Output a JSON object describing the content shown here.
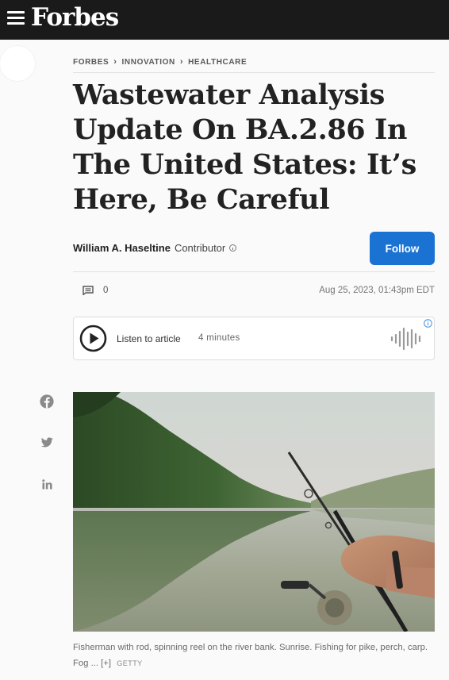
{
  "header": {
    "logo": "Forbes"
  },
  "breadcrumb": [
    "FORBES",
    "INNOVATION",
    "HEALTHCARE"
  ],
  "article": {
    "title_lines": [
      "Wastewater Analysis",
      "Update On BA.2.86 In",
      "The United States: It’s",
      "Here, Be Careful"
    ],
    "author": "William A. Haseltine",
    "role": "Contributor",
    "follow_label": "Follow",
    "comment_count": "0",
    "timestamp": "Aug 25, 2023, 01:43pm EDT"
  },
  "listen": {
    "label": "Listen to article",
    "duration": "4 minutes"
  },
  "social": [
    "facebook-icon",
    "twitter-icon",
    "linkedin-icon"
  ],
  "image": {
    "caption": "Fisherman with rod, spinning reel on the river bank. Sunrise. Fishing for pike, perch, carp. Fog ...",
    "expand": "[+]",
    "credit": "GETTY"
  },
  "colors": {
    "topbar": "#1a1a1a",
    "follow": "#1a73d2"
  }
}
